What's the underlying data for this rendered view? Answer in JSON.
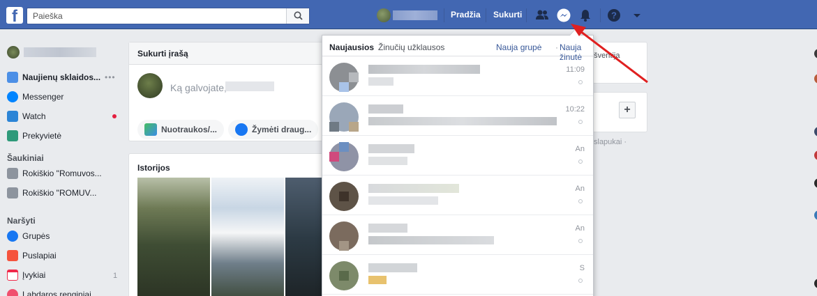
{
  "topbar": {
    "logo": "f",
    "search_placeholder": "Paieška",
    "nav": [
      "Pradžia",
      "Sukurti"
    ],
    "icons": [
      "friends-icon",
      "messenger-icon",
      "notifications-icon",
      "help-icon",
      "caret-down-icon"
    ],
    "brand_color": "#4267b2"
  },
  "sidebar": {
    "items": [
      {
        "label": "Naujienų sklaidos...",
        "more": "•••",
        "active": true
      },
      {
        "label": "Messenger"
      },
      {
        "label": "Watch"
      },
      {
        "label": "Prekyvietė"
      }
    ],
    "shortcuts_title": "Šaukiniai",
    "shortcuts": [
      {
        "label": "Rokiškio \"Romuvos..."
      },
      {
        "label": "Rokiškio \"ROMUV..."
      }
    ],
    "explore_title": "Naršyti",
    "explore": [
      {
        "label": "Grupės"
      },
      {
        "label": "Puslapiai"
      },
      {
        "label": "Įvykiai",
        "count": "1"
      },
      {
        "label": "Labdaros renginiai"
      }
    ]
  },
  "composer": {
    "title": "Sukurti įrašą",
    "prompt": "Ką galvojate,",
    "actions": [
      "Nuotraukos/...",
      "Žymėti draug..."
    ]
  },
  "stories": {
    "title": "Istorijos"
  },
  "right": {
    "event_text": "n šventija",
    "cookies_text": "slapukai ·"
  },
  "messenger": {
    "tabs": [
      "Naujausios",
      "Žinučių užklausos"
    ],
    "new_group": "Nauja grupė",
    "separator": "·",
    "new_message": "Nauja žinutė",
    "threads": [
      {
        "time": "11:09"
      },
      {
        "time": "10:22"
      },
      {
        "time": "An"
      },
      {
        "time": "An"
      },
      {
        "time": "An"
      },
      {
        "time": "S"
      }
    ]
  }
}
